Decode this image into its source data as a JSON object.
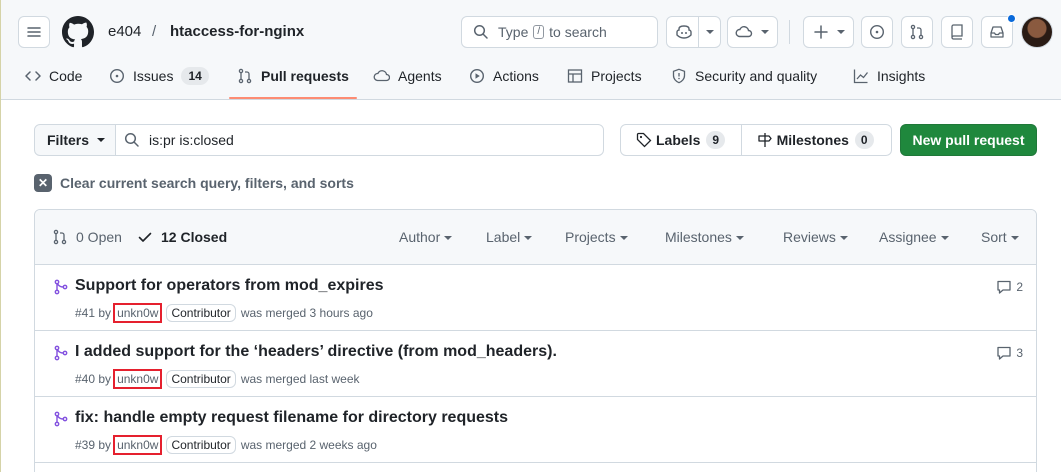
{
  "header": {
    "owner": "e404",
    "separator": "/",
    "repo": "htaccess-for-nginx",
    "search_type": "Type",
    "search_key": "/",
    "search_rest": "to search"
  },
  "tabs": [
    {
      "label": "Code"
    },
    {
      "label": "Issues",
      "count": "14"
    },
    {
      "label": "Pull requests"
    },
    {
      "label": "Agents"
    },
    {
      "label": "Actions"
    },
    {
      "label": "Projects"
    },
    {
      "label": "Security and quality"
    },
    {
      "label": "Insights"
    }
  ],
  "filters": {
    "button": "Filters",
    "query": "is:pr is:closed",
    "labels": "Labels",
    "labels_count": "9",
    "milestones": "Milestones",
    "milestones_count": "0",
    "new_pr": "New pull request",
    "clear": "Clear current search query, filters, and sorts"
  },
  "list": {
    "open": "0 Open",
    "closed": "12 Closed",
    "filter_menus": [
      "Author",
      "Label",
      "Projects",
      "Milestones",
      "Reviews",
      "Assignee",
      "Sort"
    ]
  },
  "pull_requests": [
    {
      "title": "Support for operators from mod_expires",
      "number": "#41",
      "by": "by",
      "user": "unkn0w",
      "badge": "Contributor",
      "status": "was merged 3 hours ago",
      "comments": "2"
    },
    {
      "title": "I added support for the ‘headers’ directive (from mod_headers).",
      "number": "#40",
      "by": "by",
      "user": "unkn0w",
      "badge": "Contributor",
      "status": "was merged last week",
      "comments": "3"
    },
    {
      "title": "fix: handle empty request filename for directory requests",
      "number": "#39",
      "by": "by",
      "user": "unkn0w",
      "badge": "Contributor",
      "status": "was merged 2 weeks ago",
      "comments": ""
    }
  ],
  "colors": {
    "merged": "#8250df",
    "primary": "#1f883d",
    "tab_underline": "#fd8c73",
    "highlight": "#e5202e"
  }
}
